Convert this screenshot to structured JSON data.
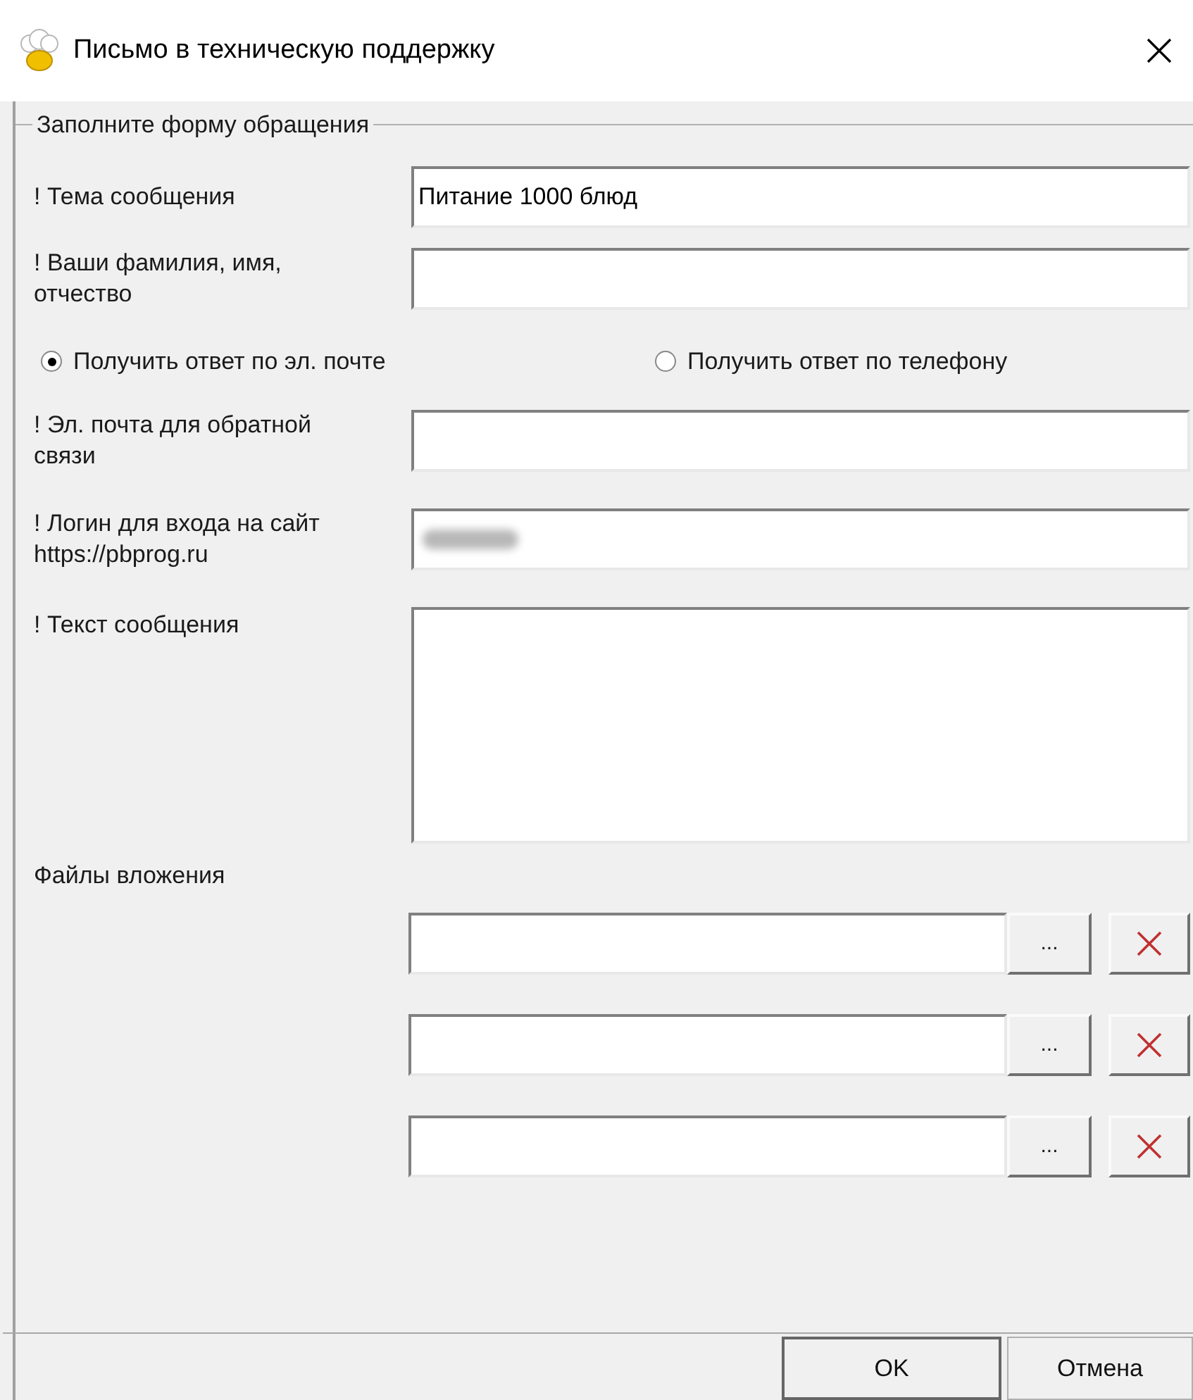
{
  "window": {
    "title": "Письмо в техническую поддержку"
  },
  "group": {
    "title": "Заполните форму обращения"
  },
  "fields_top": [
    {
      "label": "! Тема сообщения",
      "value": "Питание 1000 блюд"
    },
    {
      "label": "! Ваши фамилия, имя, отчество"
    }
  ],
  "reply_options": [
    {
      "label": "Получить ответ по эл. почте",
      "selected": true
    },
    {
      "label": "Получить ответ по телефону",
      "selected": false
    }
  ],
  "fields_bottom": [
    {
      "label": "! Эл. почта для обратной связи",
      "kind": "text"
    },
    {
      "label": "! Логин для входа на сайт https://pbprog.ru",
      "kind": "text",
      "blurred": true
    },
    {
      "label": "! Текст сообщения",
      "kind": "textarea"
    }
  ],
  "attachments": {
    "label": "Файлы вложения",
    "rows": [
      {
        "browse": "..."
      },
      {
        "browse": "..."
      },
      {
        "browse": "..."
      }
    ]
  },
  "buttons": [
    {
      "label": "OK",
      "default": true
    },
    {
      "label": "Отмена",
      "default": false
    }
  ]
}
